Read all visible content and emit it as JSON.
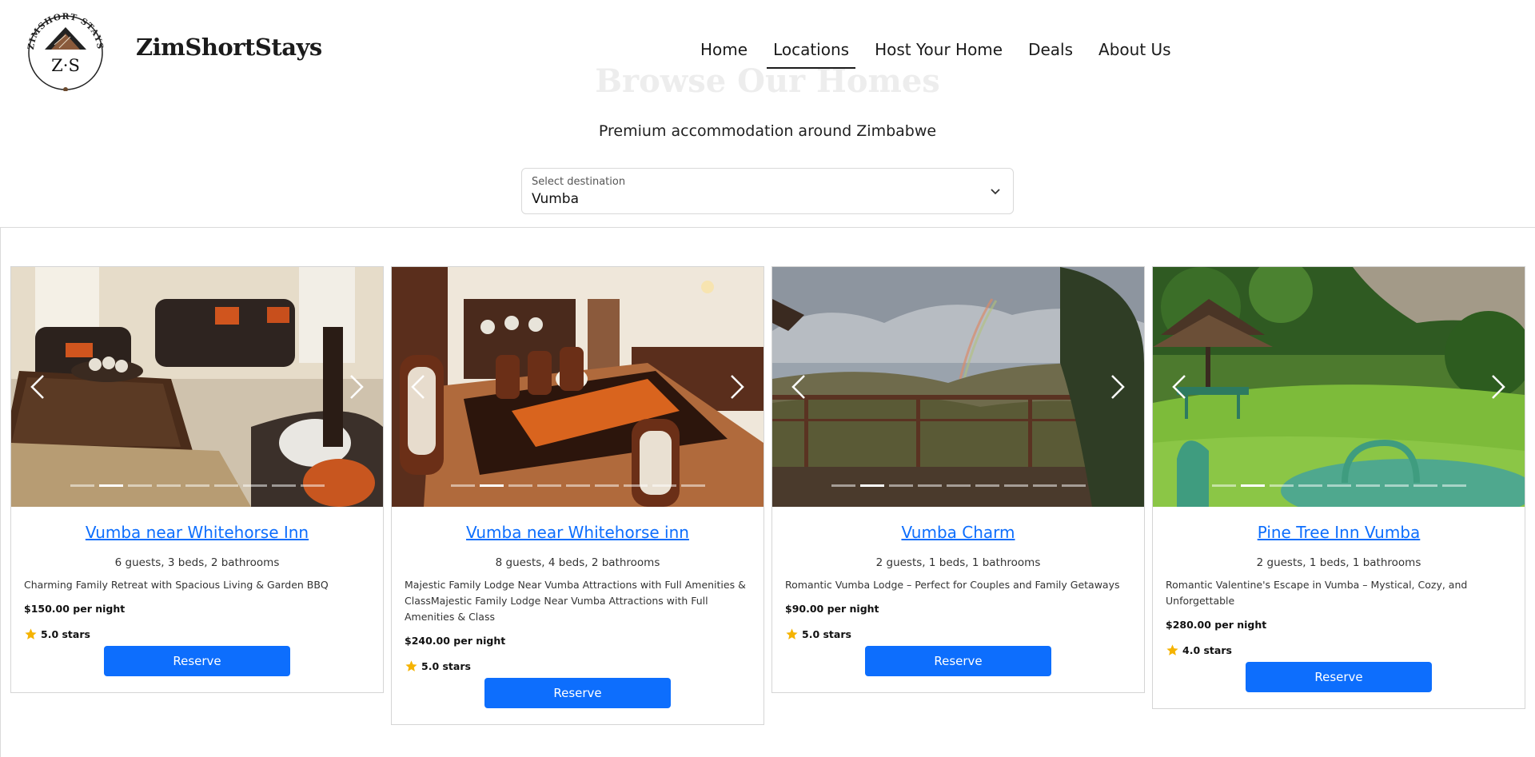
{
  "brand": {
    "name": "ZimShortStays",
    "logo_text_top": "ZIMSHORT STAYS",
    "logo_monogram": "Z·S"
  },
  "nav": [
    "Home",
    "Locations",
    "Host Your Home",
    "Deals",
    "About Us"
  ],
  "nav_active": "Locations",
  "hero": {
    "title": "Browse Our Homes",
    "subtitle": "Premium accommodation around Zimbabwe"
  },
  "destination": {
    "label": "Select destination",
    "value": "Vumba"
  },
  "icons": {
    "prev": "chevron-left-icon",
    "next": "chevron-right-icon",
    "star": "star-icon",
    "select": "chevron-down-icon"
  },
  "colors": {
    "accent": "#0d6efd",
    "star": "#f5b301"
  },
  "listings": [
    {
      "title": "Vumba near Whitehorse Inn",
      "details": "6 guests, 3 beds, 2 bathrooms",
      "description": "Charming Family Retreat with Spacious Living & Garden BBQ",
      "price": "$150.00 per night",
      "rating": "5.0 stars",
      "button": "Reserve",
      "photo": "living room with leather sofas",
      "slides": 9,
      "active_slide": 2
    },
    {
      "title": "Vumba near Whitehorse inn",
      "details": "8 guests, 4 beds, 2 bathrooms",
      "description": "Majestic Family Lodge Near Vumba Attractions with Full Amenities & ClassMajestic Family Lodge Near Vumba Attractions with Full Amenities & Class",
      "price": "$240.00 per night",
      "rating": "5.0 stars",
      "button": "Reserve",
      "photo": "dining room with wooden table",
      "slides": 9,
      "active_slide": 2
    },
    {
      "title": "Vumba Charm",
      "details": "2 guests, 1 beds, 1 bathrooms",
      "description": "Romantic Vumba Lodge – Perfect for Couples and Family Getaways",
      "price": "$90.00 per night",
      "rating": "5.0 stars",
      "button": "Reserve",
      "photo": "mountain view with rainbow",
      "slides": 9,
      "active_slide": 2
    },
    {
      "title": "Pine Tree Inn Vumba",
      "details": "2 guests, 1 beds, 1 bathrooms",
      "description": "Romantic Valentine's Escape in Vumba – Mystical, Cozy, and Unforgettable",
      "price": "$280.00 per night",
      "rating": "4.0 stars",
      "button": "Reserve",
      "photo": "garden with green furniture",
      "slides": 9,
      "active_slide": 2
    }
  ]
}
